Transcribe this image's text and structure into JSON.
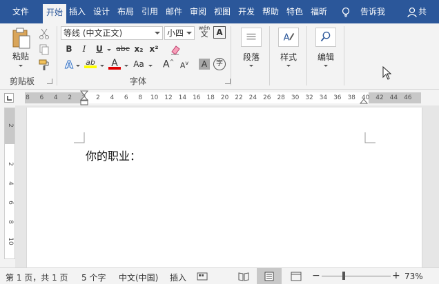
{
  "tabs": [
    "文件",
    "开始",
    "插入",
    "设计",
    "布局",
    "引用",
    "邮件",
    "审阅",
    "视图",
    "开发",
    "帮助",
    "特色",
    "福昕"
  ],
  "active_tab": "开始",
  "tell_me": "告诉我",
  "share": "共",
  "clipboard": {
    "paste_label": "粘贴",
    "group_label": "剪贴板"
  },
  "font": {
    "font_name": "等线 (中文正文)",
    "font_size": "小四",
    "wen_glyph": "wén",
    "group_label": "字体",
    "bold": "B",
    "italic": "I",
    "underline": "U",
    "strike": "abc",
    "subscript": "x₂",
    "superscript": "x²",
    "text_effects": "A",
    "highlight": "ab",
    "font_color": "A",
    "change_case": "Aa",
    "grow": "A",
    "shrink": "A",
    "char_shading": "A",
    "enclose": "字"
  },
  "paragraph": {
    "label": "段落"
  },
  "styles": {
    "label": "样式"
  },
  "editing": {
    "label": "编辑"
  },
  "ruler": {
    "marks": [
      "8",
      "6",
      "4",
      "2",
      "2",
      "2",
      "4",
      "6",
      "8",
      "10",
      "12",
      "14",
      "16",
      "18",
      "20",
      "22",
      "24",
      "26",
      "28",
      "30",
      "32",
      "34",
      "36",
      "38",
      "40",
      "42",
      "44",
      "46"
    ],
    "tab_selector": "L"
  },
  "vruler": {
    "marks": [
      "2",
      "2",
      "4",
      "6",
      "8",
      "10"
    ]
  },
  "document": {
    "text": "你的职业："
  },
  "status": {
    "page": "第 1 页，共 1 页",
    "words": "5 个字",
    "language": "中文(中国)",
    "mode": "插入",
    "zoom": "73%",
    "zoom_minus": "−",
    "zoom_plus": "+"
  },
  "colors": {
    "brand": "#2b579a",
    "highlight": "#ffff00",
    "font_color": "#e00000"
  }
}
